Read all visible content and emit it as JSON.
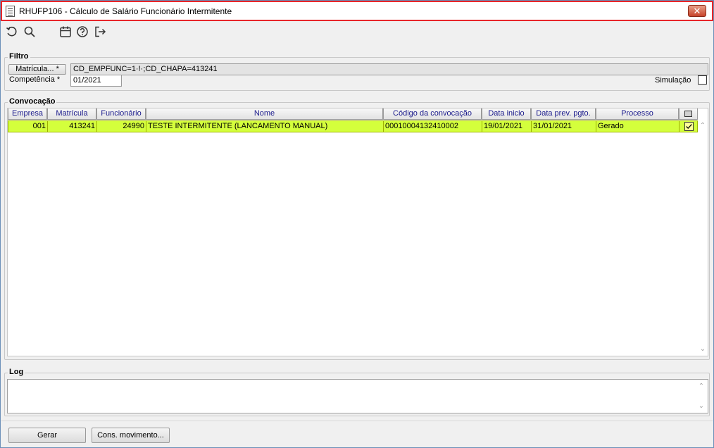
{
  "window": {
    "title": "RHUFP106 - Cálculo de Salário Funcionário Intermitente",
    "close_glyph": "✕"
  },
  "toolbar": {
    "icons": [
      "refresh-icon",
      "search-icon",
      "calendar-icon",
      "help-icon",
      "exit-icon"
    ]
  },
  "filtro": {
    "label": "Filtro",
    "matricula_button": "Matrícula... *",
    "matricula_value": "CD_EMPFUNC=1·!·;CD_CHAPA=413241",
    "competencia_label": "Competência *",
    "competencia_value": "01/2021",
    "simulacao_label": "Simulação"
  },
  "convocacao": {
    "label": "Convocação",
    "columns": [
      "Empresa",
      "Matrícula",
      "Funcionário",
      "Nome",
      "Código da convocação",
      "Data inicio",
      "Data prev. pgto.",
      "Processo"
    ],
    "rows": [
      {
        "empresa": "001",
        "matricula": "413241",
        "funcionario": "24990",
        "nome": "TESTE INTERMITENTE (LANCAMENTO MANUAL)",
        "codigo": "00010004132410002",
        "data_inicio": "19/01/2021",
        "data_prev": "31/01/2021",
        "processo": "Gerado",
        "checked": true
      }
    ],
    "selected_row_color": "#d4ff3c"
  },
  "log": {
    "label": "Log"
  },
  "footer": {
    "gerar_button": "Gerar",
    "cons_button": "Cons. movimento..."
  }
}
